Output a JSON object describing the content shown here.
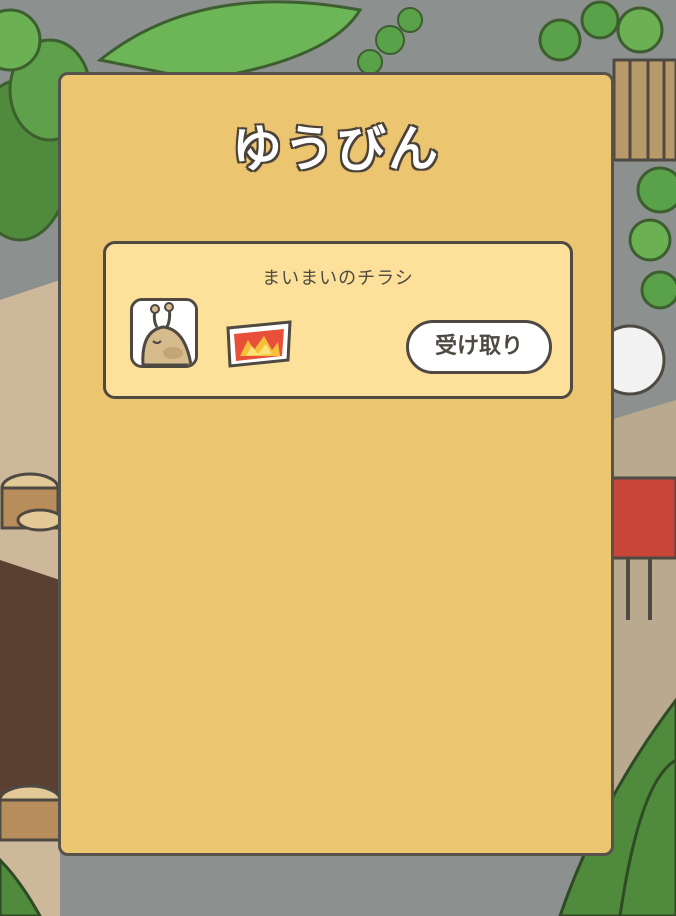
{
  "mailbox": {
    "title": "ゆうびん",
    "items": [
      {
        "title": "まいまいのチラシ",
        "sender_icon": "snail-character-icon",
        "attachment_icon": "flyer-icon",
        "receive_label": "受け取り"
      }
    ]
  },
  "colors": {
    "panel_bg": "#ecc570",
    "item_bg": "#fde09a",
    "outline": "#4e4a42",
    "button_bg": "#ffffff"
  }
}
